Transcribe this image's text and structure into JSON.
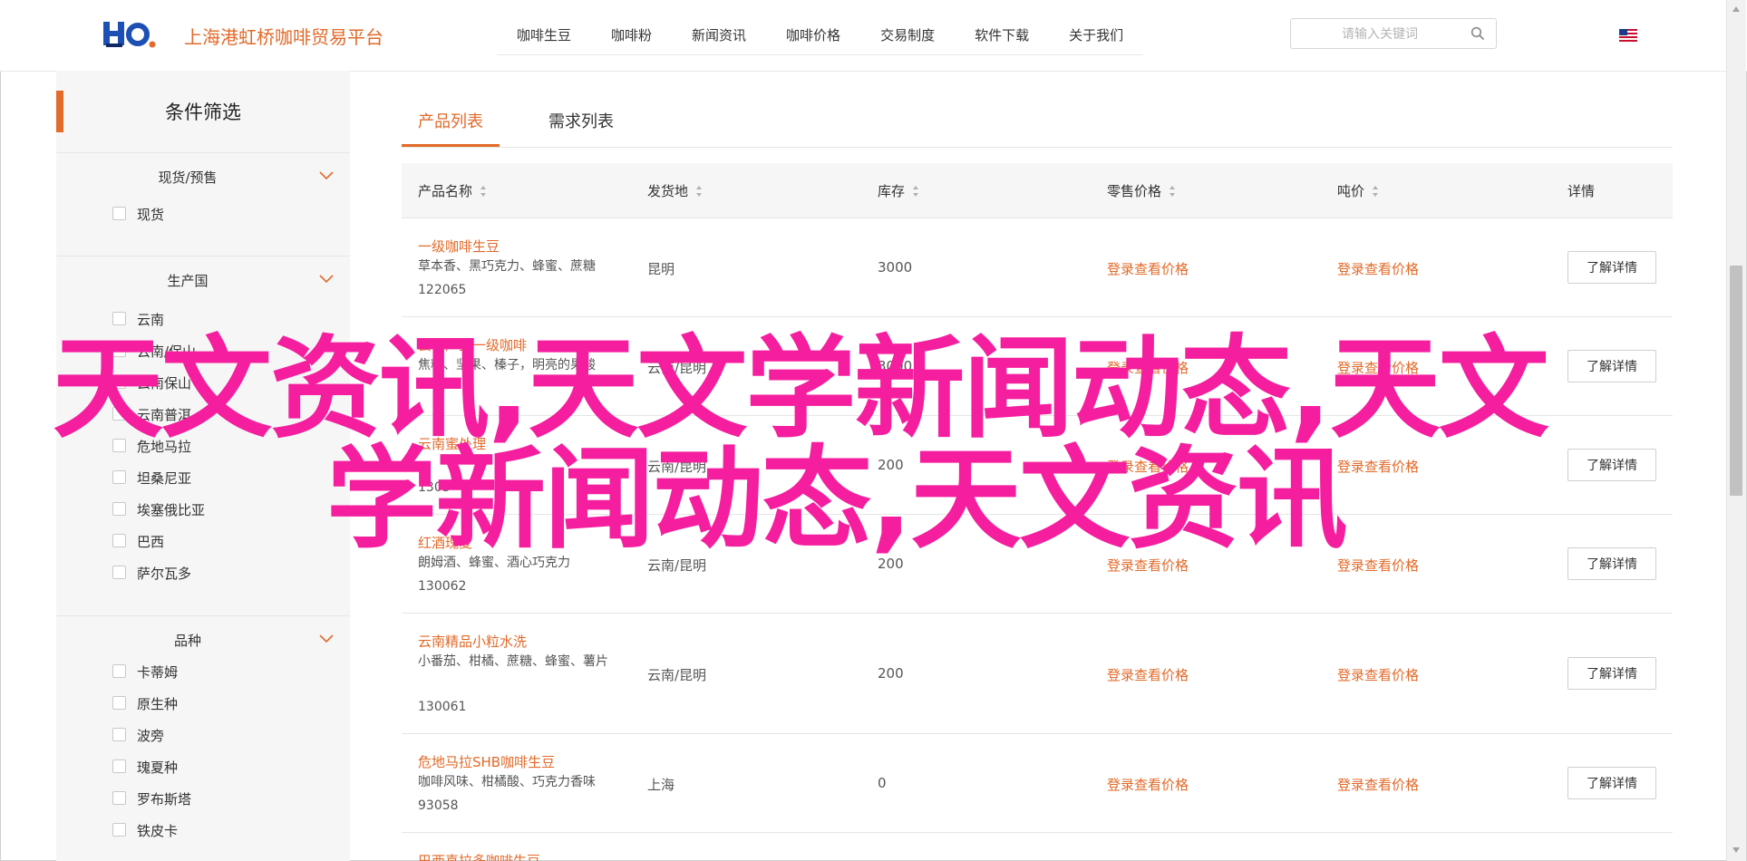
{
  "header": {
    "logo_text": "HO.",
    "site_title": "上海港虹桥咖啡贸易平台",
    "nav": [
      "咖啡生豆",
      "咖啡粉",
      "新闻资讯",
      "咖啡价格",
      "交易制度",
      "软件下载",
      "关于我们"
    ],
    "search_placeholder": "请输入关键词",
    "flag_icon": "us-flag-icon"
  },
  "sidebar": {
    "title": "条件筛选",
    "groups": [
      {
        "title": "现货/预售",
        "options": [
          "现货"
        ]
      },
      {
        "title": "生产国",
        "options": [
          "云南",
          "云南/保山",
          "云南保山",
          "云南普洱",
          "危地马拉",
          "坦桑尼亚",
          "埃塞俄比亚",
          "巴西",
          "萨尔瓦多"
        ]
      },
      {
        "title": "品种",
        "options": [
          "卡蒂姆",
          "原生种",
          "波旁",
          "瑰夏种",
          "罗布斯塔",
          "铁皮卡"
        ]
      }
    ]
  },
  "tabs": [
    {
      "label": "产品列表",
      "active": true
    },
    {
      "label": "需求列表",
      "active": false
    }
  ],
  "table": {
    "columns": [
      "产品名称",
      "发货地",
      "库存",
      "零售价格",
      "吨价",
      "详情"
    ],
    "rows": [
      {
        "name": "一级咖啡生豆",
        "desc": "草本香、黑巧克力、蜂蜜、蔗糖",
        "code": "122065",
        "origin": "昆明",
        "stock": "3000",
        "retail": "登录查看价格",
        "ton": "登录查看价格",
        "detail": "了解详情"
      },
      {
        "name": "云南产业一级咖啡",
        "desc": "焦糖、坚果、榛子，明亮的果酸",
        "code": "",
        "origin": "云南/昆明",
        "stock": "3000",
        "retail": "登录查看价格",
        "ton": "登录查看价格",
        "detail": "了解详情"
      },
      {
        "name": "云南蜜处理",
        "desc": "",
        "code": "1303",
        "origin": "云南/昆明",
        "stock": "200",
        "retail": "登录查看价格",
        "ton": "登录查看价格",
        "detail": "了解详情"
      },
      {
        "name": "红酒瑰夏",
        "desc": "朗姆酒、蜂蜜、酒心巧克力",
        "code": "130062",
        "origin": "云南/昆明",
        "stock": "200",
        "retail": "登录查看价格",
        "ton": "登录查看价格",
        "detail": "了解详情"
      },
      {
        "name": "云南精品小粒水洗",
        "desc": "小番茄、柑橘、蔗糖、蜂蜜、薯片",
        "code": "130061",
        "origin": "云南/昆明",
        "stock": "200",
        "retail": "登录查看价格",
        "ton": "登录查看价格",
        "detail": "了解详情"
      },
      {
        "name": "危地马拉SHB咖啡生豆",
        "desc": "咖啡风味、柑橘酸、巧克力香味",
        "code": "93058",
        "origin": "上海",
        "stock": "0",
        "retail": "登录查看价格",
        "ton": "登录查看价格",
        "detail": "了解详情"
      },
      {
        "name": "巴西喜拉多咖啡生豆",
        "desc": "",
        "code": "",
        "origin": "",
        "stock": "",
        "retail": "",
        "ton": "",
        "detail": ""
      }
    ]
  },
  "overlay": {
    "line1": "天文资讯,天文学新闻动态,天文",
    "line2": "学新闻动态,天文资讯",
    "color": "#f51e9f"
  },
  "colors": {
    "accent": "#e26a2a",
    "overlay": "#f51e9f"
  }
}
